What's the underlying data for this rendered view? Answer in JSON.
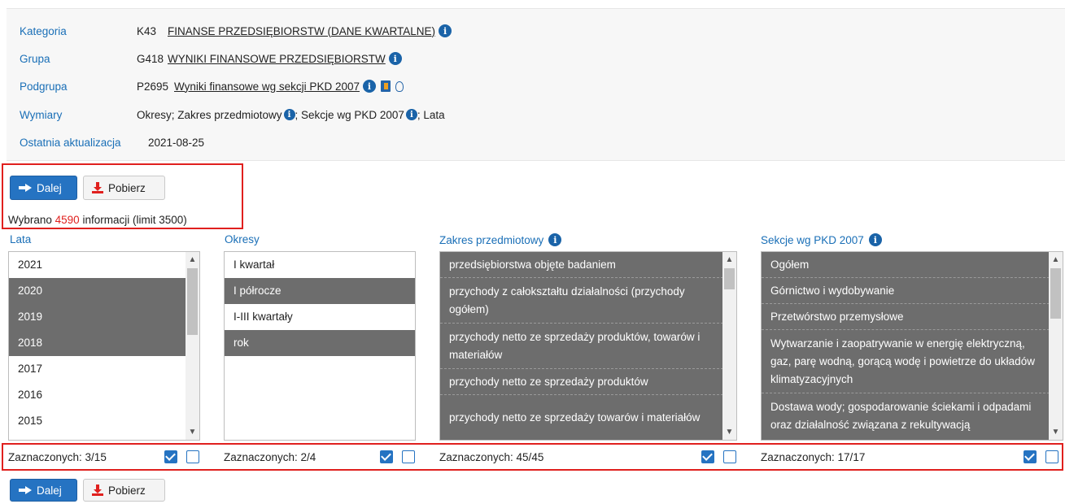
{
  "info": {
    "kategoria": {
      "label": "Kategoria",
      "code": "K43",
      "value": "FINANSE PRZEDSIĘBIORSTW (DANE KWARTALNE)"
    },
    "grupa": {
      "label": "Grupa",
      "code": "G418",
      "value": "WYNIKI FINANSOWE PRZEDSIĘBIORSTW"
    },
    "podgrupa": {
      "label": "Podgrupa",
      "code": "P2695",
      "value": "Wyniki finansowe wg sekcji PKD 2007"
    },
    "wymiary": {
      "label": "Wymiary",
      "part1": "Okresy; Zakres przedmiotowy",
      "part2": "; Sekcje wg PKD 2007",
      "part3": "; Lata"
    },
    "aktualizacja": {
      "label": "Ostatnia aktualizacja",
      "value": "2021-08-25"
    }
  },
  "buttons": {
    "dalej": "Dalej",
    "pobierz": "Pobierz"
  },
  "selection": {
    "prefix": "Wybrano ",
    "count": "4590",
    "suffix": " informacji (limit 3500)"
  },
  "columns": {
    "lata": {
      "title": "Lata",
      "items": [
        {
          "label": "2021",
          "selected": false
        },
        {
          "label": "2020",
          "selected": true
        },
        {
          "label": "2019",
          "selected": true
        },
        {
          "label": "2018",
          "selected": true
        },
        {
          "label": "2017",
          "selected": false
        },
        {
          "label": "2016",
          "selected": false
        },
        {
          "label": "2015",
          "selected": false
        }
      ],
      "footer": "Zaznaczonych: 3/15"
    },
    "okresy": {
      "title": "Okresy",
      "items": [
        {
          "label": "I kwartał",
          "selected": false
        },
        {
          "label": "I półrocze",
          "selected": true
        },
        {
          "label": "I-III kwartały",
          "selected": false
        },
        {
          "label": "rok",
          "selected": true
        }
      ],
      "footer": "Zaznaczonych: 2/4"
    },
    "zakres": {
      "title": "Zakres przedmiotowy",
      "items": [
        {
          "label": "przedsiębiorstwa objęte badaniem",
          "selected": true
        },
        {
          "label": "przychody z całokształtu działalności (przychody ogółem)",
          "selected": true
        },
        {
          "label": "przychody netto ze sprzedaży produktów, towarów i materiałów",
          "selected": true
        },
        {
          "label": "przychody netto ze sprzedaży produktów",
          "selected": true
        },
        {
          "label": "przychody netto ze sprzedaży towarów i materiałów",
          "selected": true
        }
      ],
      "footer": "Zaznaczonych: 45/45"
    },
    "sekcje": {
      "title": "Sekcje wg PKD 2007",
      "items": [
        {
          "label": "Ogółem",
          "selected": true
        },
        {
          "label": "Górnictwo i wydobywanie",
          "selected": true
        },
        {
          "label": "Przetwórstwo przemysłowe",
          "selected": true
        },
        {
          "label": "Wytwarzanie i zaopatrywanie w energię elektryczną, gaz, parę wodną, gorącą wodę i powietrze do układów klimatyzacyjnych",
          "selected": true
        },
        {
          "label": "Dostawa wody; gospodarowanie ściekami i odpadami oraz działalność związana z rekultywacją",
          "selected": true
        }
      ],
      "footer": "Zaznaczonych: 17/17"
    }
  }
}
